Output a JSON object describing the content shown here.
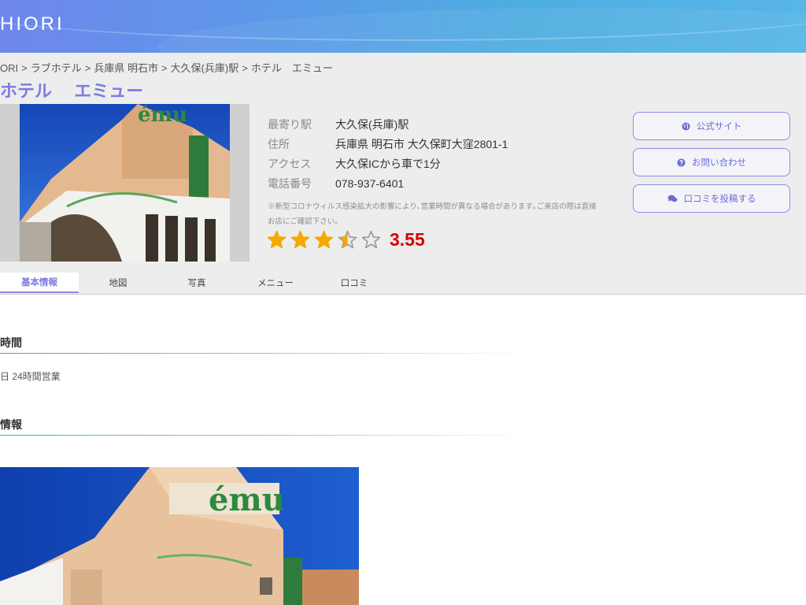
{
  "header": {
    "logo": "HIORI"
  },
  "breadcrumb": [
    "ORI",
    ">",
    "ラブホテル",
    ">",
    "兵庫県 明石市",
    ">",
    "大久保(兵庫)駅",
    ">",
    "ホテル　エミュー"
  ],
  "title": "ホテル　 エミュー",
  "photo": {
    "sign_text": "ému"
  },
  "info": [
    {
      "label": "最寄り駅",
      "value": "大久保(兵庫)駅"
    },
    {
      "label": "住所",
      "value": "兵庫県 明石市 大久保町大窪2801-1"
    },
    {
      "label": "アクセス",
      "value": "大久保ICから車で1分"
    },
    {
      "label": "電話番号",
      "value": "078-937-6401"
    }
  ],
  "notice": "※新型コロナウィルス感染拡大の影響により､営業時間が異なる場合があります｡ご来店の際は直接お店にご確認下さい｡",
  "rating": {
    "score": "3.55",
    "value": 3.55,
    "max": 5,
    "star_color": "#f5a800"
  },
  "buttons": [
    {
      "label": "公式サイト",
      "icon": "globe-icon"
    },
    {
      "label": "お問い合わせ",
      "icon": "question-circle-icon"
    },
    {
      "label": "口コミを投稿する",
      "icon": "comments-icon"
    }
  ],
  "tabs": [
    {
      "label": "基本情報",
      "active": true
    },
    {
      "label": "地図",
      "active": false
    },
    {
      "label": "写真",
      "active": false
    },
    {
      "label": "メニュー",
      "active": false
    },
    {
      "label": "口コミ",
      "active": false
    }
  ],
  "sections": {
    "hours_title": "時間",
    "hours_value": "日 24時間営業",
    "info_title": "情報"
  },
  "colors": {
    "accent": "#7b7ce0",
    "score": "#d40000",
    "header_from": "#6f86ec",
    "header_to": "#4eaee0"
  }
}
